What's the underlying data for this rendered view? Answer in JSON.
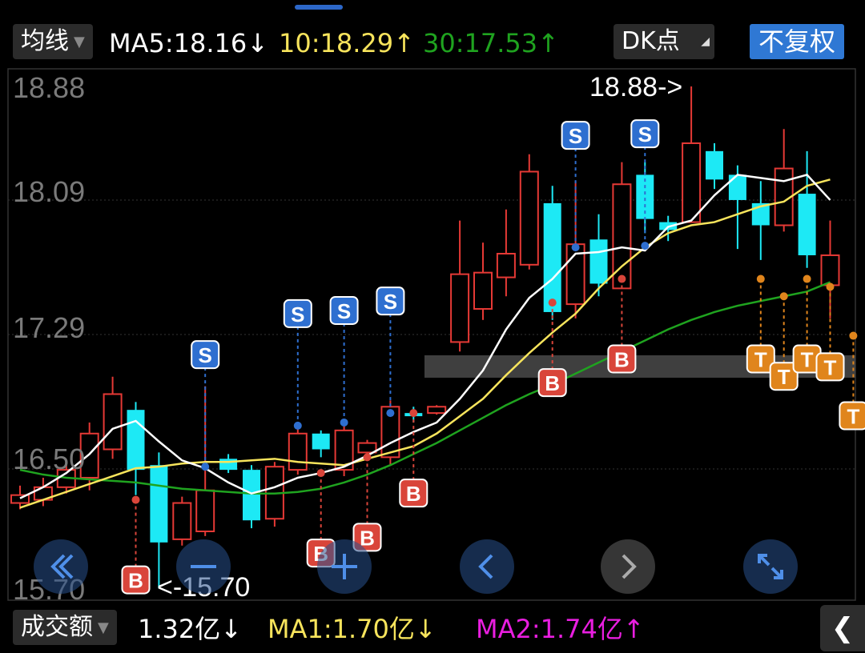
{
  "header": {
    "indicator_select": "均线",
    "ma5": "MA5:18.16↓",
    "ma10": "10:18.29↑",
    "ma30": "30:17.53↑",
    "dk_select": "DK点",
    "adjust_button": "不复权"
  },
  "footer": {
    "volume_select": "成交额",
    "volume_value": "1.32亿↓",
    "vol_ma1": "MA1:1.70亿↓",
    "vol_ma2": "MA2:1.74亿↑"
  },
  "colors": {
    "up": "#e53935",
    "down": "#1de9f5",
    "ma5": "#ffffff",
    "ma10": "#f7e45c",
    "ma30": "#1fa31f",
    "vol_ma2": "#e91ee0",
    "buy_badge": "#d9453a",
    "sell_badge": "#2e6fd0",
    "t_badge": "#e0851c"
  },
  "nav_icons": [
    "double-chevron-left-icon",
    "minus-icon",
    "plus-icon",
    "chevron-left-icon",
    "chevron-right-icon",
    "expand-icon"
  ],
  "chart_data": {
    "type": "candlestick",
    "y_ticks": [
      "18.88",
      "18.09",
      "17.29",
      "16.50",
      "15.70"
    ],
    "ylim": [
      15.7,
      18.88
    ],
    "high_label": "18.88->",
    "low_label": "<-15.70",
    "candles": [
      {
        "o": 16.24,
        "c": 16.29,
        "h": 16.35,
        "l": 16.2
      },
      {
        "o": 16.26,
        "c": 16.34,
        "h": 16.4,
        "l": 16.22
      },
      {
        "o": 16.34,
        "c": 16.45,
        "h": 16.5,
        "l": 16.3
      },
      {
        "o": 16.4,
        "c": 16.68,
        "h": 16.75,
        "l": 16.32
      },
      {
        "o": 16.58,
        "c": 16.93,
        "h": 17.04,
        "l": 16.52
      },
      {
        "o": 16.83,
        "c": 16.45,
        "h": 16.88,
        "l": 16.29
      },
      {
        "o": 16.48,
        "c": 15.99,
        "h": 16.56,
        "l": 15.7
      },
      {
        "o": 16.01,
        "c": 16.24,
        "h": 16.28,
        "l": 15.97
      },
      {
        "o": 16.06,
        "c": 16.32,
        "h": 16.98,
        "l": 16.03
      },
      {
        "o": 16.52,
        "c": 16.45,
        "h": 16.55,
        "l": 16.43
      },
      {
        "o": 16.45,
        "c": 16.13,
        "h": 16.48,
        "l": 16.08
      },
      {
        "o": 16.14,
        "c": 16.47,
        "h": 16.5,
        "l": 16.09
      },
      {
        "o": 16.45,
        "c": 16.68,
        "h": 16.73,
        "l": 16.42
      },
      {
        "o": 16.68,
        "c": 16.58,
        "h": 16.7,
        "l": 16.53
      },
      {
        "o": 16.45,
        "c": 16.7,
        "h": 16.77,
        "l": 16.41
      },
      {
        "o": 16.56,
        "c": 16.62,
        "h": 16.64,
        "l": 16.54
      },
      {
        "o": 16.53,
        "c": 16.85,
        "h": 16.89,
        "l": 16.48
      },
      {
        "o": 16.81,
        "c": 16.79,
        "h": 16.85,
        "l": 16.75
      },
      {
        "o": 16.81,
        "c": 16.85,
        "h": 16.86,
        "l": 16.8
      },
      {
        "o": 17.26,
        "c": 17.69,
        "h": 18.03,
        "l": 17.2
      },
      {
        "o": 17.47,
        "c": 17.7,
        "h": 17.89,
        "l": 17.4
      },
      {
        "o": 17.67,
        "c": 17.82,
        "h": 18.1,
        "l": 17.55
      },
      {
        "o": 17.75,
        "c": 18.34,
        "h": 18.45,
        "l": 17.72
      },
      {
        "o": 18.14,
        "c": 17.45,
        "h": 18.25,
        "l": 17.4
      },
      {
        "o": 17.5,
        "c": 17.88,
        "h": 18.28,
        "l": 17.41
      },
      {
        "o": 17.91,
        "c": 17.63,
        "h": 18.07,
        "l": 17.55
      },
      {
        "o": 17.6,
        "c": 18.26,
        "h": 18.4,
        "l": 17.6
      },
      {
        "o": 18.32,
        "c": 18.04,
        "h": 18.4,
        "l": 17.95
      },
      {
        "o": 18.02,
        "c": 17.97,
        "h": 18.06,
        "l": 17.9
      },
      {
        "o": 18.02,
        "c": 18.52,
        "h": 18.88,
        "l": 18.02
      },
      {
        "o": 18.47,
        "c": 18.29,
        "h": 18.52,
        "l": 18.23
      },
      {
        "o": 18.32,
        "c": 18.16,
        "h": 18.38,
        "l": 17.85
      },
      {
        "o": 18.14,
        "c": 18.0,
        "h": 18.28,
        "l": 17.78
      },
      {
        "o": 18.0,
        "c": 18.36,
        "h": 18.61,
        "l": 17.96
      },
      {
        "o": 18.2,
        "c": 17.81,
        "h": 18.47,
        "l": 17.73
      },
      {
        "o": 17.62,
        "c": 17.81,
        "h": 18.03,
        "l": 17.41
      }
    ],
    "ma5": [
      16.27,
      16.34,
      16.43,
      16.55,
      16.71,
      16.76,
      16.63,
      16.51,
      16.46,
      16.37,
      16.3,
      16.34,
      16.4,
      16.43,
      16.47,
      16.54,
      16.62,
      16.69,
      16.75,
      16.9,
      17.08,
      17.34,
      17.54,
      17.66,
      17.82,
      17.83,
      17.86,
      17.84,
      17.99,
      18.03,
      18.19,
      18.32,
      18.3,
      18.28,
      18.32,
      18.16
    ],
    "ma10": [
      16.21,
      16.26,
      16.31,
      16.36,
      16.41,
      16.46,
      16.47,
      16.49,
      16.5,
      16.5,
      16.51,
      16.52,
      16.5,
      16.49,
      16.48,
      16.52,
      16.56,
      16.6,
      16.68,
      16.79,
      16.9,
      17.05,
      17.19,
      17.32,
      17.44,
      17.6,
      17.74,
      17.86,
      17.95,
      18.0,
      18.02,
      18.07,
      18.12,
      18.15,
      18.25,
      18.29
    ],
    "ma30": [
      16.45,
      16.42,
      16.4,
      16.39,
      16.38,
      16.37,
      16.35,
      16.33,
      16.32,
      16.31,
      16.3,
      16.3,
      16.31,
      16.33,
      16.37,
      16.42,
      16.48,
      16.55,
      16.62,
      16.7,
      16.78,
      16.86,
      16.93,
      16.99,
      17.06,
      17.13,
      17.2,
      17.27,
      17.34,
      17.4,
      17.45,
      17.49,
      17.52,
      17.55,
      17.58,
      17.64
    ],
    "signals": [
      {
        "i": 5,
        "type": "B",
        "price": 16.26
      },
      {
        "i": 8,
        "type": "S",
        "price": 16.47
      },
      {
        "i": 12,
        "type": "S",
        "price": 16.73
      },
      {
        "i": 13,
        "type": "B",
        "price": 16.43
      },
      {
        "i": 14,
        "type": "S",
        "price": 16.75
      },
      {
        "i": 15,
        "type": "B",
        "price": 16.53
      },
      {
        "i": 16,
        "type": "S",
        "price": 16.81
      },
      {
        "i": 17,
        "type": "B",
        "price": 16.81
      },
      {
        "i": 23,
        "type": "B",
        "price": 17.51
      },
      {
        "i": 24,
        "type": "S",
        "price": 17.86
      },
      {
        "i": 26,
        "type": "B",
        "price": 17.66
      },
      {
        "i": 27,
        "type": "S",
        "price": 17.87
      },
      {
        "i": 32,
        "type": "T",
        "price": 17.66
      },
      {
        "i": 33,
        "type": "T",
        "price": 17.55
      },
      {
        "i": 34,
        "type": "T",
        "price": 17.66
      },
      {
        "i": 35,
        "type": "T",
        "price": 17.61
      },
      {
        "i": 36,
        "type": "T",
        "price": 17.3
      }
    ]
  }
}
